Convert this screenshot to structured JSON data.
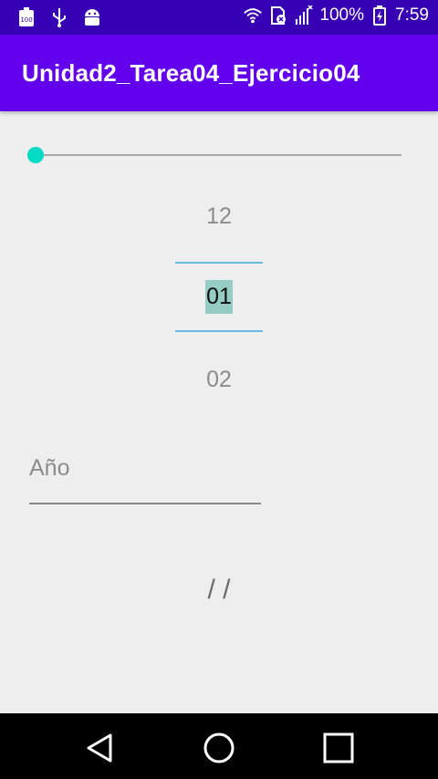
{
  "status_bar": {
    "left_icons": [
      "battery-saver-icon",
      "usb-icon",
      "android-debug-icon"
    ],
    "battery_saver_text": "100",
    "right_icons": [
      "wifi-icon",
      "sim-off-icon",
      "signal-icon",
      "battery-charging-icon"
    ],
    "battery_percent": "100%",
    "time": "7:59"
  },
  "app_bar": {
    "title": "Unidad2_Tarea04_Ejercicio04"
  },
  "seekbar": {
    "progress": 0,
    "accent_color": "#03dac5"
  },
  "number_picker": {
    "previous": "12",
    "selected": "01",
    "next": "02"
  },
  "year_field": {
    "placeholder": "Año",
    "value": ""
  },
  "date_output": {
    "text": "/ /"
  },
  "colors": {
    "status_bar": "#3700b3",
    "app_bar": "#6200ee",
    "background": "#eeeeee",
    "accent": "#03dac5"
  }
}
